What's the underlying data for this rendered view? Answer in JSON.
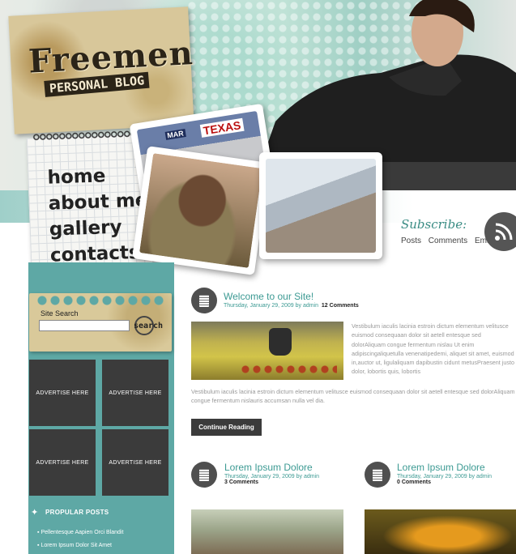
{
  "site": {
    "logo_title": "Freemen",
    "logo_subtitle": "PERSONAL BLOG"
  },
  "nav": {
    "items": [
      "home",
      "about me",
      "gallery",
      "contacts"
    ]
  },
  "photos": {
    "texas_sign": "TEXAS",
    "mar_sign": "MAR"
  },
  "subscribe": {
    "title": "Subscribe:",
    "links": [
      "Posts",
      "Comments",
      "Email"
    ]
  },
  "sidebar": {
    "search_label": "Site Search",
    "search_value": "",
    "search_button": "search",
    "ads": [
      "ADVERTISE HERE",
      "ADVERTISE HERE",
      "ADVERTISE HERE",
      "ADVERTISE HERE"
    ],
    "popular_title": "PROPULAR POSTS",
    "popular_posts": [
      "Pellentesque Aapien Orci Blandit",
      "Lorem Ipsum Dolor Sit Amet"
    ]
  },
  "main": {
    "featured": {
      "title": "Welcome to our Site!",
      "date": "Thursday, January 29, 2009 by",
      "author": "admin",
      "comments": "12 Comments",
      "excerpt_side": "Vestibulum iaculis lacinia estroin dictum elementum velitusce euismod consequaan dolor sit aetell entesque sed dolorAliquam congue fermentum nislau Ut enim adipiscingaliquetulla venenatipedemi, aliquet sit amet, euismod in,auctor ut, ligulaliquam dapibustin cidunt metusPraesent justo dolor, lobortis quis, lobortis",
      "excerpt_full": "Vestibulum iaculis lacinia estroin dictum elementum velitusce euismod consequaan dolor sit aetell entesque sed dolorAliquam congue fermentum nislauris accumsan nulla vel dia.",
      "continue": "Continue Reading"
    },
    "posts": [
      {
        "title": "Lorem Ipsum Dolore",
        "date": "Thursday, January 29, 2009 by",
        "author": "admin",
        "comments": "3 Comments"
      },
      {
        "title": "Lorem Ipsum Dolore",
        "date": "Thursday, January 29, 2009 by",
        "author": "admin",
        "comments": "0 Comments"
      }
    ]
  },
  "colors": {
    "accent_teal": "#3c9a93",
    "sidebar_teal": "#5ea8a5",
    "dark_gray": "#3b3b3b"
  }
}
